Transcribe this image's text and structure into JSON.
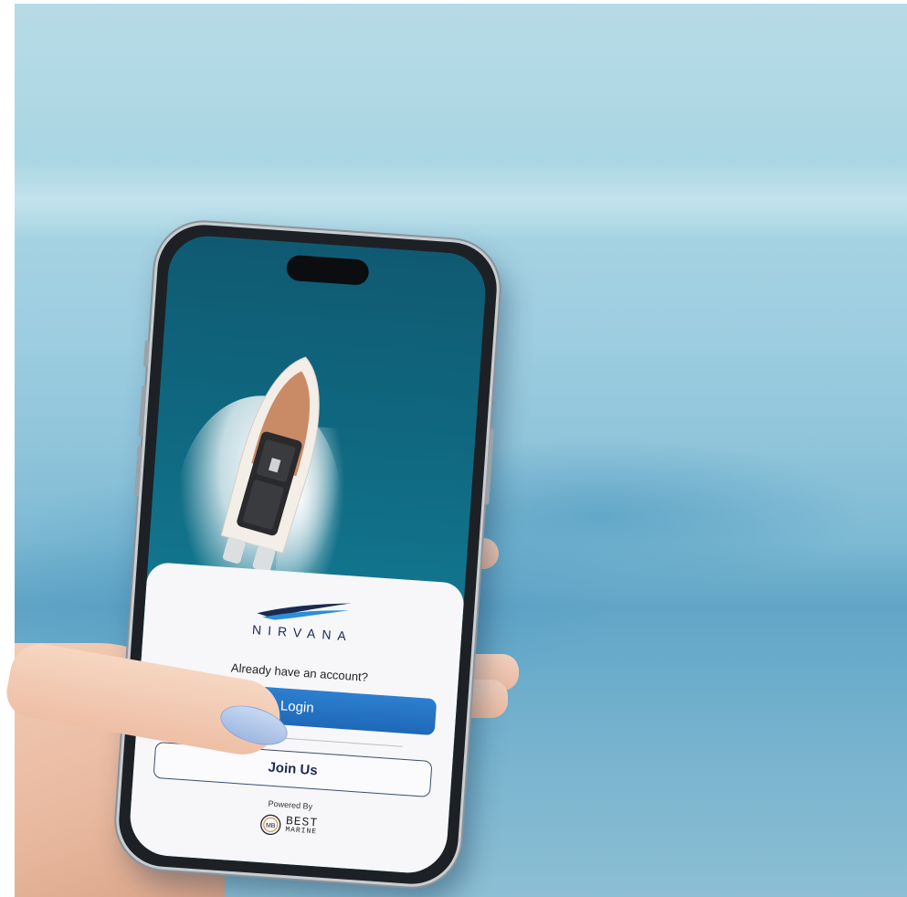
{
  "app": {
    "brand_name": "NIRVANA",
    "prompt_text": "Already have an account?",
    "login_label": "Login",
    "join_label": "Join Us",
    "powered_by": "Powered By",
    "partner_line1": "BEST",
    "partner_line2": "MARINE",
    "partner_monogram": "MB"
  },
  "colors": {
    "primary_button": "#1f68b8",
    "brand_navy": "#1c2a52",
    "sea": "#0f6a82"
  },
  "icons": [
    "nirvana-logo-icon",
    "best-marine-logo-icon",
    "boat-illustration"
  ]
}
